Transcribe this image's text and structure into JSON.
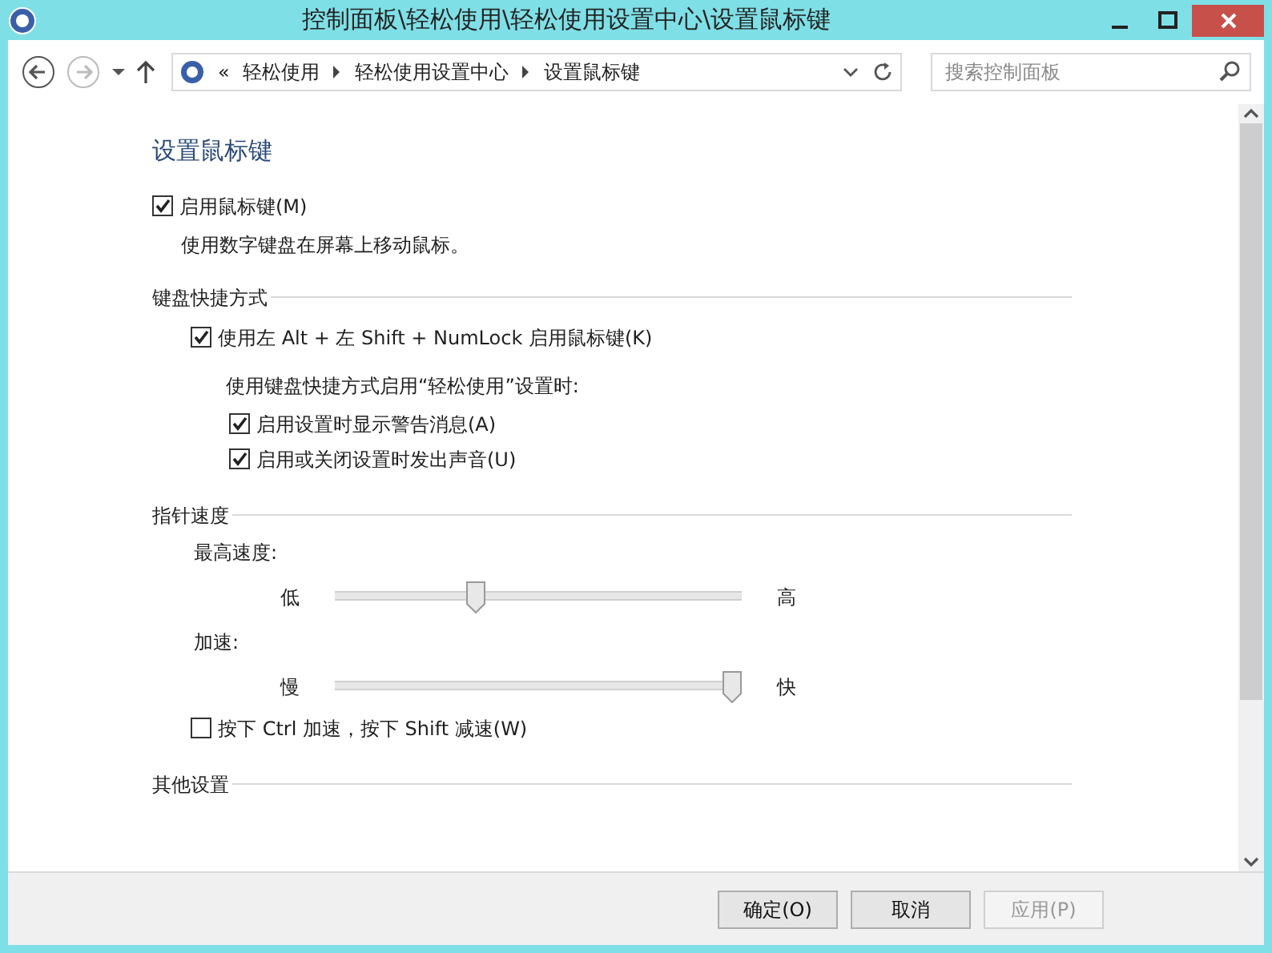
{
  "window": {
    "title": "控制面板\\轻松使用\\轻松使用设置中心\\设置鼠标键"
  },
  "address_bar": {
    "overflow": "«",
    "path": [
      "轻松使用",
      "轻松使用设置中心",
      "设置鼠标键"
    ],
    "search": {
      "placeholder": "搜索控制面板"
    }
  },
  "nav": {
    "back_disabled": false,
    "forward_disabled": true
  },
  "heading": "设置鼠标键",
  "top_items": [
    {
      "kind": "checkbox",
      "label": "启用鼠标键(M)",
      "checked": true
    },
    {
      "kind": "note",
      "label": "使用数字键盘在屏幕上移动鼠标。"
    }
  ],
  "sections": [
    {
      "title": "键盘快捷方式",
      "items": [
        {
          "kind": "checkbox",
          "label": "使用左 Alt + 左 Shift + NumLock 启用鼠标键(K)",
          "checked": true
        },
        {
          "kind": "group",
          "label": "使用键盘快捷方式启用“轻松使用”设置时:",
          "children": [
            {
              "kind": "checkbox",
              "label": "启用设置时显示警告消息(A)",
              "checked": true
            },
            {
              "kind": "checkbox",
              "label": "启用或关闭设置时发出声音(U)",
              "checked": true
            }
          ]
        }
      ]
    },
    {
      "title": "指针速度",
      "items": [
        {
          "kind": "slider",
          "label": "最高速度:",
          "low": "低",
          "high": "高",
          "level": 0.34
        },
        {
          "kind": "slider",
          "label": "加速:",
          "low": "慢",
          "high": "快",
          "level": 1
        },
        {
          "kind": "checkbox",
          "label": "按下 Ctrl 加速，按下 Shift 减速(W)",
          "checked": false
        }
      ]
    },
    {
      "title": "其他设置"
    }
  ],
  "buttons": [
    {
      "label": "确定(O)",
      "disabled": false
    },
    {
      "label": "取消",
      "disabled": false
    },
    {
      "label": "应用(P)",
      "disabled": true
    }
  ]
}
